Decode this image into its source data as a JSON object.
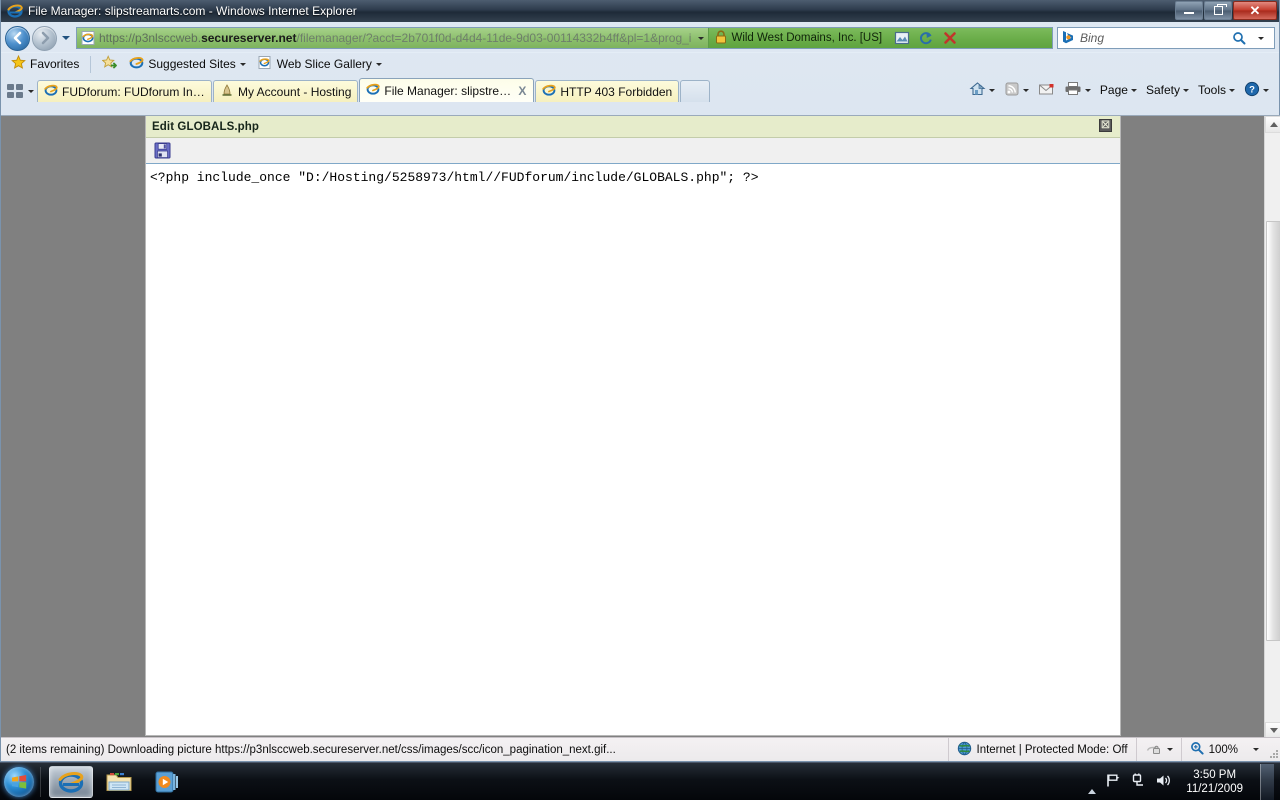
{
  "window": {
    "title": "File Manager: slipstreamarts.com - Windows Internet Explorer",
    "minimize_label": "Minimize",
    "restore_label": "Restore",
    "close_label": "Close"
  },
  "nav": {
    "back_label": "Back",
    "forward_label": "Forward",
    "recent_pages_label": "Recent Pages"
  },
  "address": {
    "scheme": "https",
    "separator": "://",
    "host_prefix": "p3nlsccweb.",
    "host_strong": "secureserver.net",
    "path": "/filemanager/?acct=2b701f0d-d4d4-11de-9d03-00114332b4ff&pl=1&prog_i",
    "full_url": "https://p3nlsccweb.secureserver.net/filemanager/?acct=2b701f0d-d4d4-11de-9d03-00114332b4ff&pl=1&prog_i",
    "ev_certificate": "Wild West Domains, Inc. [US]",
    "compatibility_label": "Compatibility View",
    "refresh_label": "Refresh",
    "stop_label": "Stop"
  },
  "search": {
    "provider": "Bing",
    "placeholder": "Bing",
    "go_label": "Search",
    "dropdown_label": "Search Options"
  },
  "favorites_bar": {
    "favorites_label": "Favorites",
    "add_label": "Add to Favorites Bar",
    "items": [
      {
        "label": "Suggested Sites",
        "has_caret": true
      },
      {
        "label": "Web Slice Gallery",
        "has_caret": true
      }
    ]
  },
  "tabs": {
    "quick_tabs_label": "Quick Tabs",
    "tab_list_label": "Tab List",
    "new_tab_label": "New Tab",
    "items": [
      {
        "label": "FUDforum: FUDforum Inst...",
        "active": false,
        "closeable": false
      },
      {
        "label": "My Account - Hosting",
        "active": false,
        "closeable": false
      },
      {
        "label": "File Manager: slipstrea...",
        "active": true,
        "closeable": true,
        "close_glyph": "X"
      },
      {
        "label": "HTTP 403 Forbidden",
        "active": false,
        "closeable": false
      }
    ]
  },
  "command_bar": {
    "home_label": "Home",
    "feeds_label": "Feeds",
    "mail_label": "Read Mail",
    "print_label": "Print",
    "items": [
      {
        "label": "Page",
        "caret": true
      },
      {
        "label": "Safety",
        "caret": true
      },
      {
        "label": "Tools",
        "caret": true
      }
    ],
    "help_label": "Help"
  },
  "editor": {
    "panel_title": "Edit GLOBALS.php",
    "close_glyph": "☒",
    "close_label": "Close Editor",
    "save_label": "Save",
    "code": "<?php include_once \"D:/Hosting/5258973/html//FUDforum/include/GLOBALS.php\"; ?>"
  },
  "status_bar": {
    "message": "(2 items remaining) Downloading picture https://p3nlsccweb.secureserver.net/css/images/scc/icon_pagination_next.gif...",
    "zone": "Internet | Protected Mode: Off",
    "privacy_label": "Privacy Report",
    "zoom_level": "100%",
    "zoom_label": "Change Zoom Level"
  },
  "taskbar": {
    "start_label": "Start",
    "apps": [
      {
        "name": "internet-explorer",
        "active": true
      },
      {
        "name": "windows-explorer",
        "active": false
      },
      {
        "name": "windows-media-player",
        "active": false
      }
    ],
    "tray": {
      "show_hidden_label": "Show hidden icons",
      "action_center_label": "Action Center",
      "network_label": "Network",
      "volume_label": "Volume",
      "time": "3:50 PM",
      "date": "11/21/2009",
      "show_desktop_label": "Show desktop"
    }
  },
  "colors": {
    "ev_green": "#6aad49",
    "address_green": "#8cbf6d",
    "panel_header": "#e6eccb",
    "page_background": "#808080",
    "tab_active": "#fffff7"
  }
}
